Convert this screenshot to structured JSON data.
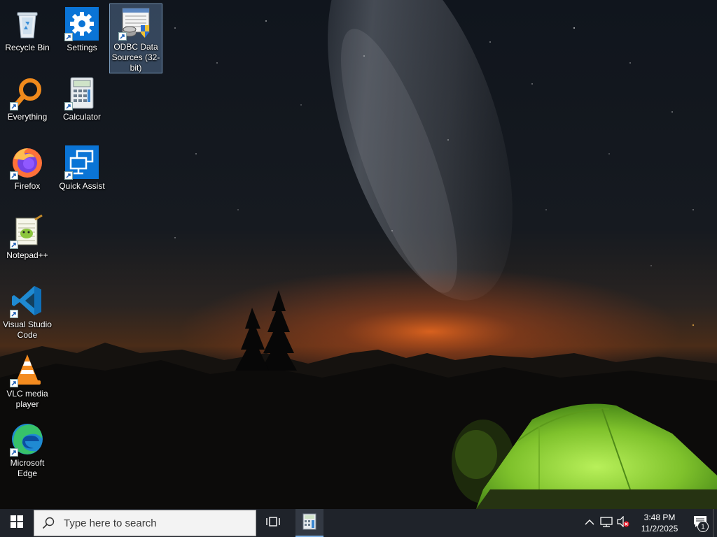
{
  "desktop": {
    "icons": [
      {
        "label": "Recycle Bin",
        "icon": "recycle-bin-icon",
        "shortcut": false
      },
      {
        "label": "Settings",
        "icon": "settings-gear-icon",
        "shortcut": true
      },
      {
        "label": "ODBC Data Sources (32-bit)",
        "icon": "odbc-icon",
        "shortcut": true,
        "selected": true
      },
      {
        "label": "Everything",
        "icon": "everything-search-icon",
        "shortcut": true
      },
      {
        "label": "Calculator",
        "icon": "calculator-icon",
        "shortcut": true
      },
      {
        "label": "Firefox",
        "icon": "firefox-icon",
        "shortcut": true
      },
      {
        "label": "Quick Assist",
        "icon": "quick-assist-icon",
        "shortcut": true
      },
      {
        "label": "Notepad++",
        "icon": "notepad-plus-plus-icon",
        "shortcut": true
      },
      {
        "label": "Visual Studio Code",
        "icon": "vscode-icon",
        "shortcut": true
      },
      {
        "label": "VLC media player",
        "icon": "vlc-icon",
        "shortcut": true
      },
      {
        "label": "Microsoft Edge",
        "icon": "edge-icon",
        "shortcut": true
      }
    ]
  },
  "taskbar": {
    "search_placeholder": "Type here to search",
    "running_app": "calculator-icon",
    "clock": {
      "time": "3:48 PM",
      "date": "11/2/2025"
    },
    "notification_count": "1"
  },
  "colors": {
    "taskbar_bg": "#1f232a",
    "selection": "#78a0d2",
    "tent": "#8fd43a",
    "horizon_glow": "#e0641e"
  }
}
